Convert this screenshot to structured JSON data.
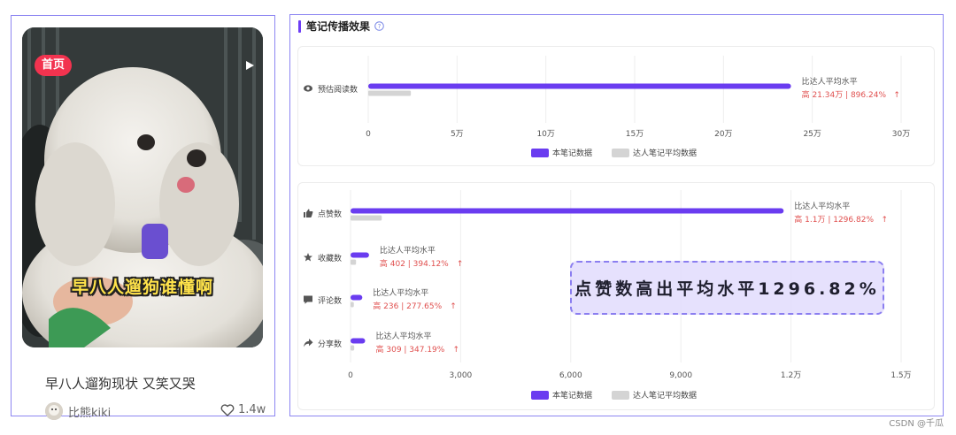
{
  "note_card": {
    "tag": "首页",
    "video_caption": "早八人遛狗谁懂啊",
    "title": "早八人遛狗现状 又笑又哭",
    "author": "比熊kiki",
    "likes": "1.4w"
  },
  "panel": {
    "title": "笔记传播效果",
    "accent": "#6d3df5",
    "callout": "点赞数高出平均水平1296.82%"
  },
  "colors": {
    "note_series": "#6a3cf0",
    "avg_series": "#d4d4d4",
    "highlight_text": "#e0504f",
    "help_icon": "#7a88e6"
  },
  "legend": {
    "note": "本笔记数据",
    "avg": "达人笔记平均数据"
  },
  "chart_data": [
    {
      "type": "bar",
      "orientation": "horizontal",
      "categories": [
        "预估阅读数"
      ],
      "category_icons": [
        "eye-icon"
      ],
      "xlim": [
        0,
        300000
      ],
      "ticks": [
        0,
        50000,
        100000,
        150000,
        200000,
        250000,
        300000
      ],
      "tick_labels": [
        "0",
        "5万",
        "10万",
        "15万",
        "20万",
        "25万",
        "30万"
      ],
      "series": [
        {
          "name": "本笔记数据",
          "values": [
            238000
          ]
        },
        {
          "name": "达人笔记平均数据",
          "values": [
            24000
          ]
        }
      ],
      "annotations": [
        {
          "label": "比达人平均水平",
          "detail": "高 21.34万 | 896.24%",
          "arrow": "↑"
        }
      ],
      "legend": "bottom-center",
      "grid": true
    },
    {
      "type": "bar",
      "orientation": "horizontal",
      "categories": [
        "点赞数",
        "收藏数",
        "评论数",
        "分享数"
      ],
      "category_icons": [
        "thumbs-up-icon",
        "star-icon",
        "comment-icon",
        "share-icon"
      ],
      "xlim": [
        0,
        15000
      ],
      "ticks": [
        0,
        3000,
        6000,
        9000,
        12000,
        15000
      ],
      "tick_labels": [
        "0",
        "3,000",
        "6,000",
        "9,000",
        "1.2万",
        "1.5万"
      ],
      "series": [
        {
          "name": "本笔记数据",
          "values": [
            11800,
            504,
            321,
            398
          ]
        },
        {
          "name": "达人笔记平均数据",
          "values": [
            850,
            150,
            90,
            100
          ]
        }
      ],
      "annotations": [
        {
          "label": "比达人平均水平",
          "detail": "高 1.1万 | 1296.82%",
          "arrow": "↑"
        },
        {
          "label": "比达人平均水平",
          "detail": "高 402 | 394.12%",
          "arrow": "↑"
        },
        {
          "label": "比达人平均水平",
          "detail": "高 236 | 277.65%",
          "arrow": "↑"
        },
        {
          "label": "比达人平均水平",
          "detail": "高 309 | 347.19%",
          "arrow": "↑"
        }
      ],
      "legend": "bottom-center",
      "grid": true
    }
  ],
  "watermark": "CSDN @千瓜"
}
